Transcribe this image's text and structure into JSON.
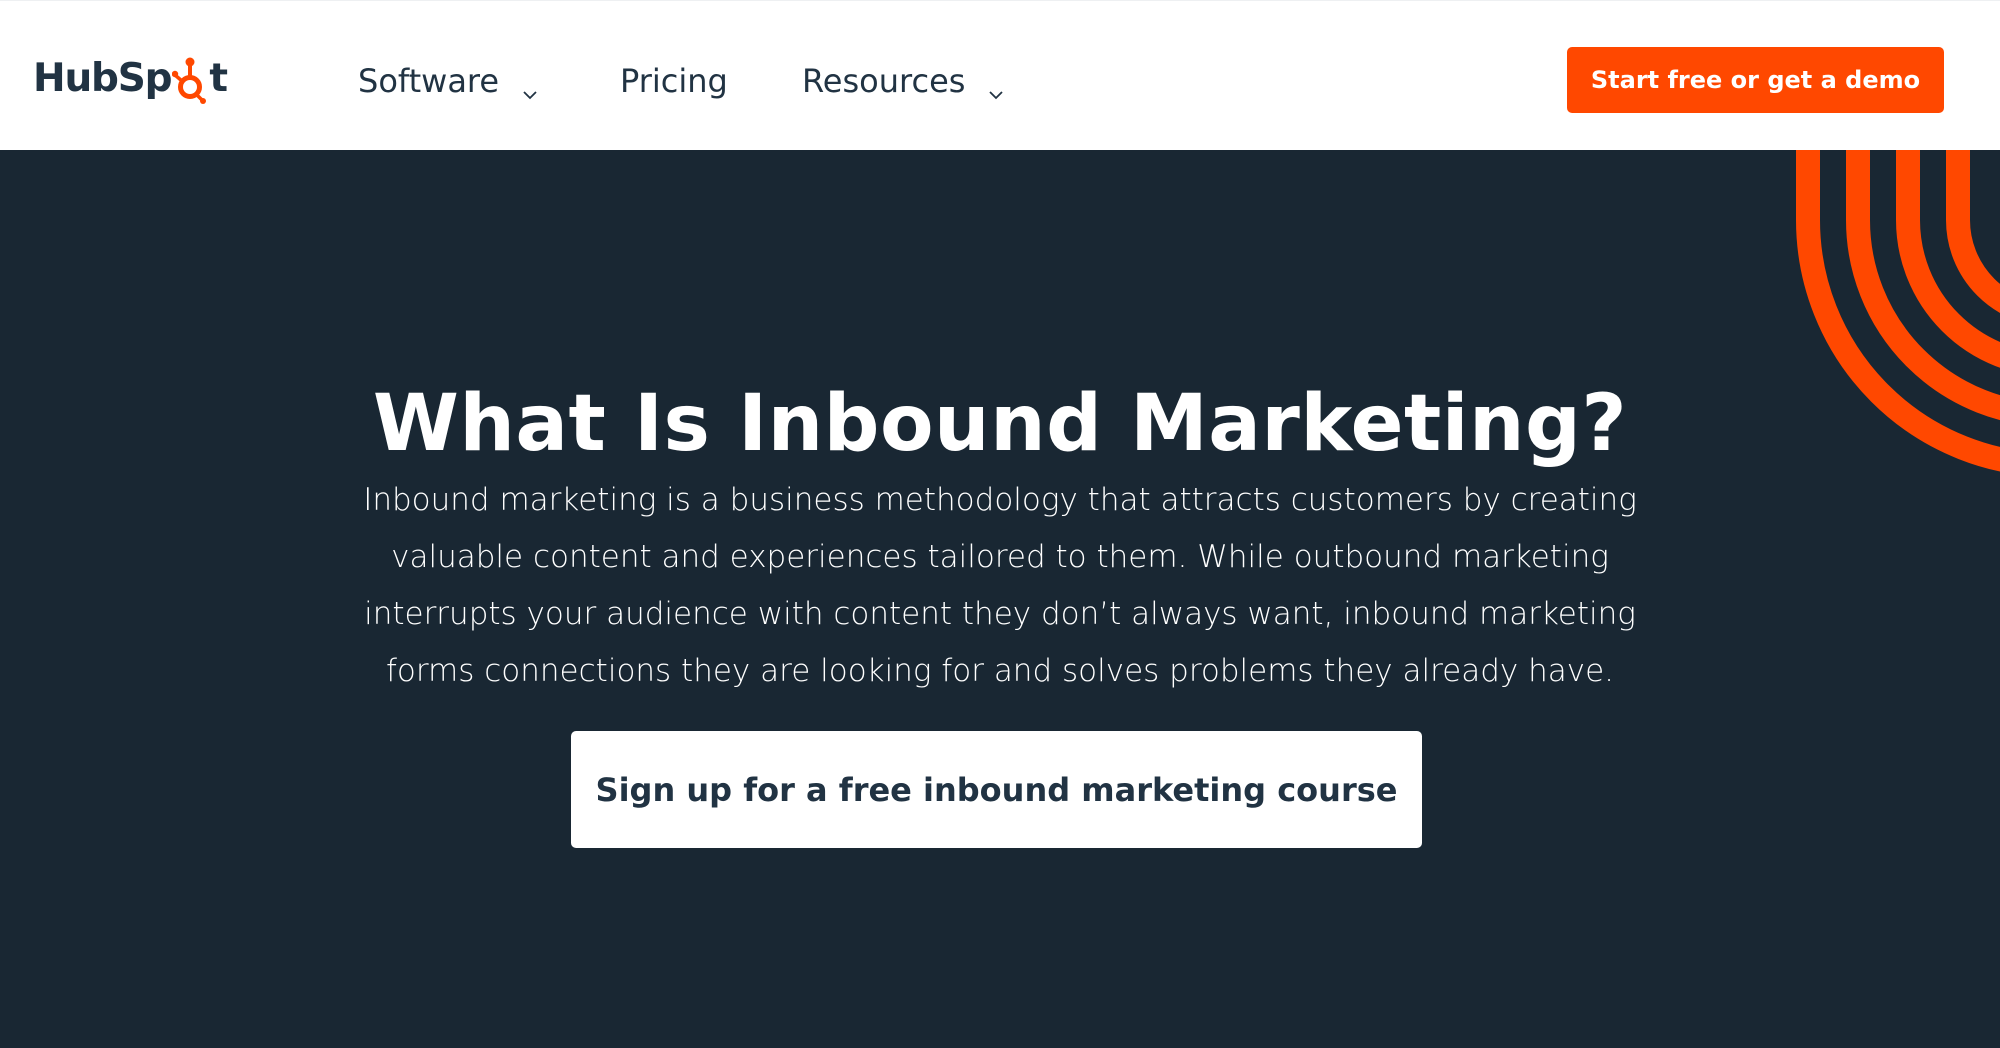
{
  "brand": {
    "logo_text_before": "HubSp",
    "logo_text_after": "t",
    "logo_icon": "sprocket-icon",
    "colors": {
      "accent": "#ff4800",
      "dark_navy": "#192733",
      "text_navy": "#213343",
      "white": "#ffffff"
    }
  },
  "nav": {
    "items": [
      {
        "label": "Software",
        "has_dropdown": true,
        "icon": "chevron-down-icon"
      },
      {
        "label": "Pricing",
        "has_dropdown": false
      },
      {
        "label": "Resources",
        "has_dropdown": true,
        "icon": "chevron-down-icon"
      }
    ],
    "cta_label": "Start free or get a demo"
  },
  "hero": {
    "title": "What Is Inbound Marketing?",
    "description": "Inbound marketing is a business methodology that attracts customers by creating valuable content and experiences tailored to them. While outbound marketing interrupts your audience with content they don’t always want, inbound marketing forms connections they are looking for and solves problems they already have.",
    "cta_label": "Sign up for a free inbound marketing course",
    "decoration": "orange-arcs"
  }
}
